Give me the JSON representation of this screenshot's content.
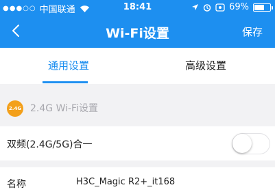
{
  "status_bar": {
    "carrier": "中国联通",
    "time": "18:41",
    "battery_text": "69%",
    "battery_level": 0.69,
    "icons": [
      "signal-dots-icon",
      "wifi-icon",
      "location-icon",
      "alarm-icon",
      "screen-lock-icon"
    ]
  },
  "navbar": {
    "back_icon": "chevron-left-icon",
    "title": "Wi-Fi设置",
    "save_label": "保存",
    "background": "#1d8ff0"
  },
  "tabs": [
    {
      "label": "通用设置",
      "active": true
    },
    {
      "label": "高级设置",
      "active": false
    }
  ],
  "section": {
    "badge_text": "2.4G",
    "title": "2.4G Wi-Fi设置",
    "badge_color": "#f3a01b"
  },
  "rows": {
    "dual_band": {
      "label": "双频(2.4G/5G)合一",
      "enabled": false
    },
    "name": {
      "label": "名称",
      "value": "H3C_Magic R2+_it168"
    }
  }
}
